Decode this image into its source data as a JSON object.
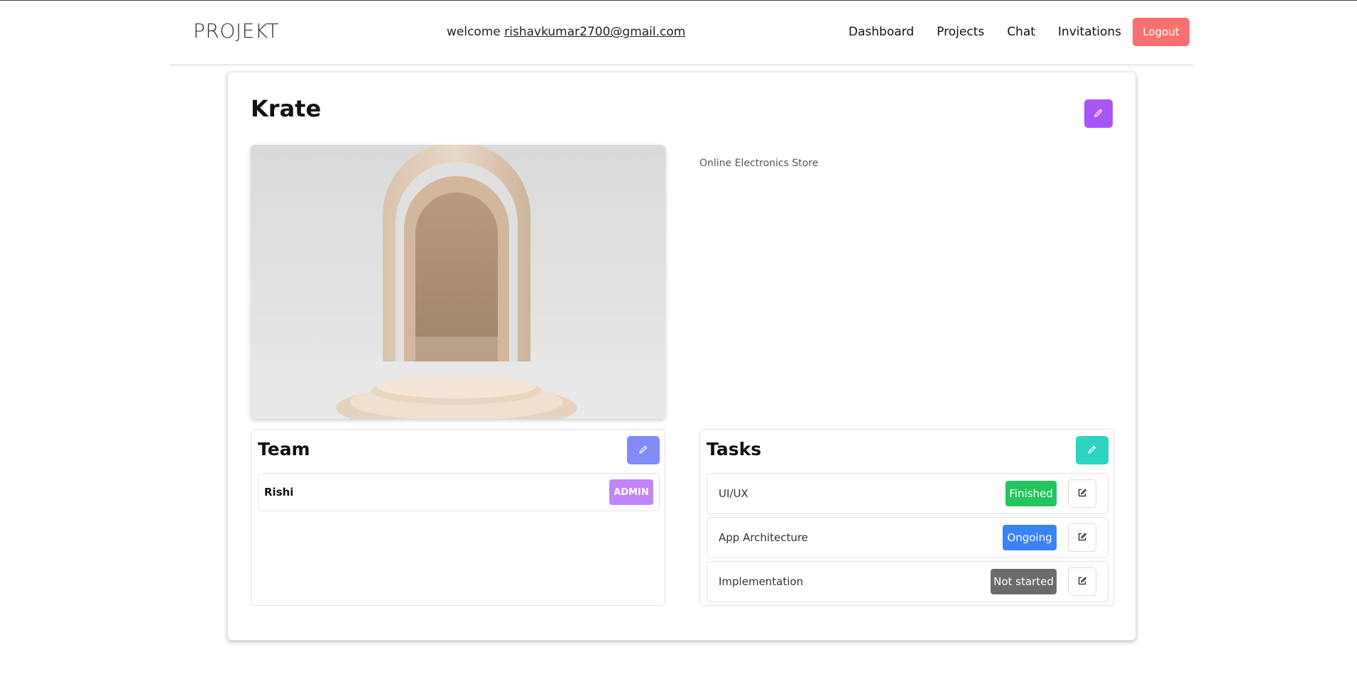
{
  "header": {
    "logo": "PROJEKT",
    "welcome_prefix": "welcome",
    "user_email": "rishavkumar2700@gmail.com",
    "nav": [
      "Dashboard",
      "Projects",
      "Chat",
      "Invitations"
    ],
    "logout_label": "Logout"
  },
  "project": {
    "title": "Krate",
    "description": "Online Electronics Store",
    "hero_image": "arch-doorway-image"
  },
  "team": {
    "title": "Team",
    "members": [
      {
        "name": "Rishi",
        "role": "ADMIN"
      }
    ]
  },
  "tasks": {
    "title": "Tasks",
    "items": [
      {
        "name": "UI/UX",
        "status": "Finished",
        "status_color": "#22c55e"
      },
      {
        "name": "App Architecture",
        "status": "Ongoing",
        "status_color": "#3b82f6"
      },
      {
        "name": "Implementation",
        "status": "Not started",
        "status_color": "#6b6b6b"
      }
    ]
  },
  "colors": {
    "logout": "#f87171",
    "project_edit": "#a855f7",
    "team_edit": "#818cf8",
    "tasks_edit": "#2dd4bf",
    "admin_badge": "#c084fc"
  }
}
